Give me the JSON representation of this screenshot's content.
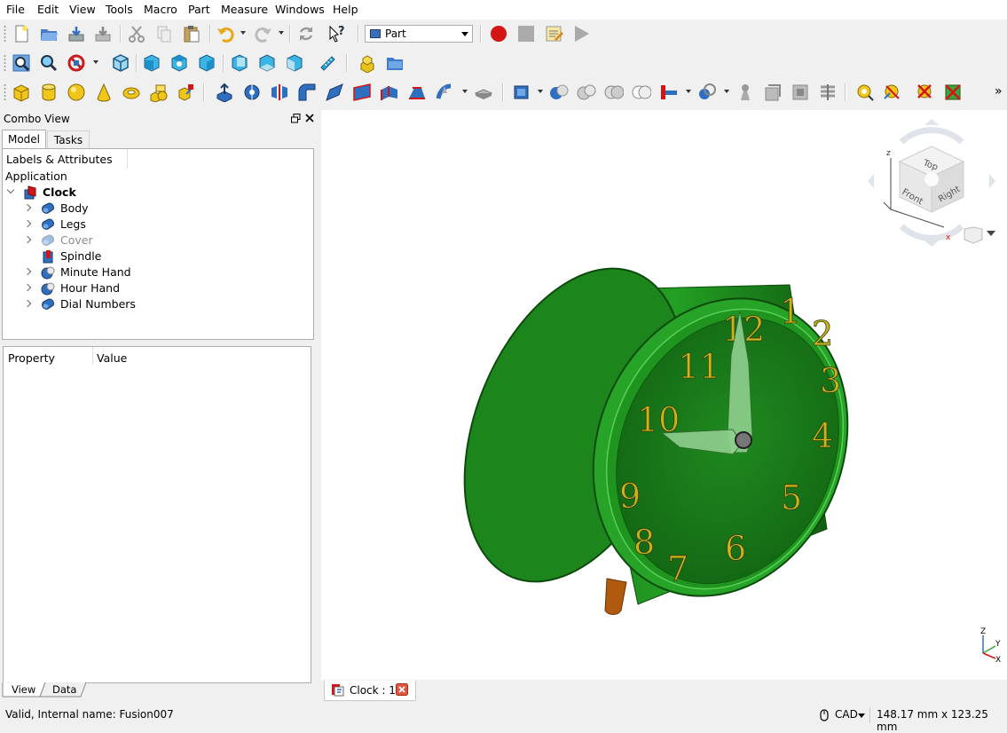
{
  "menu": [
    "File",
    "Edit",
    "View",
    "Tools",
    "Macro",
    "Part",
    "Measure",
    "Windows",
    "Help"
  ],
  "workbench": {
    "selected": "Part"
  },
  "toolbar_more": "»",
  "combo_view": {
    "title": "Combo View",
    "tabs": [
      "Model",
      "Tasks"
    ]
  },
  "tree": {
    "header": "Labels & Attributes",
    "root": "Application",
    "document": "Clock",
    "items": [
      {
        "label": "Body",
        "expandable": true,
        "muted": false,
        "icon": "shape-icon"
      },
      {
        "label": "Legs",
        "expandable": true,
        "muted": false,
        "icon": "shape-icon"
      },
      {
        "label": "Cover",
        "expandable": true,
        "muted": true,
        "icon": "shape-icon"
      },
      {
        "label": "Spindle",
        "expandable": false,
        "muted": false,
        "icon": "cut-icon"
      },
      {
        "label": "Minute Hand",
        "expandable": true,
        "muted": false,
        "icon": "fusion-icon"
      },
      {
        "label": "Hour Hand",
        "expandable": true,
        "muted": false,
        "icon": "fusion-icon"
      },
      {
        "label": "Dial Numbers",
        "expandable": true,
        "muted": false,
        "icon": "shape-icon"
      }
    ]
  },
  "property_panel": {
    "columns": [
      "Property",
      "Value"
    ]
  },
  "bottom_tabs": [
    "View",
    "Data"
  ],
  "document_tab": {
    "label": "Clock : 1*"
  },
  "navcube": {
    "faces": [
      "Top",
      "Front",
      "Right"
    ],
    "axes": [
      "z",
      "x",
      "y"
    ]
  },
  "axis_cross": {
    "labels": [
      "Z",
      "Y",
      "X"
    ]
  },
  "clock_dial": {
    "numbers": [
      "12",
      "1",
      "2",
      "3",
      "4",
      "5",
      "6",
      "7",
      "8",
      "9",
      "10",
      "11"
    ]
  },
  "status": {
    "message": "Valid, Internal name: Fusion007",
    "nav_style": "CAD",
    "dimensions": "148.17 mm x 123.25 mm"
  },
  "colors": {
    "clock_green": "#1a8a1a",
    "numerals": "#c9b51a",
    "leg": "#b05a10"
  }
}
